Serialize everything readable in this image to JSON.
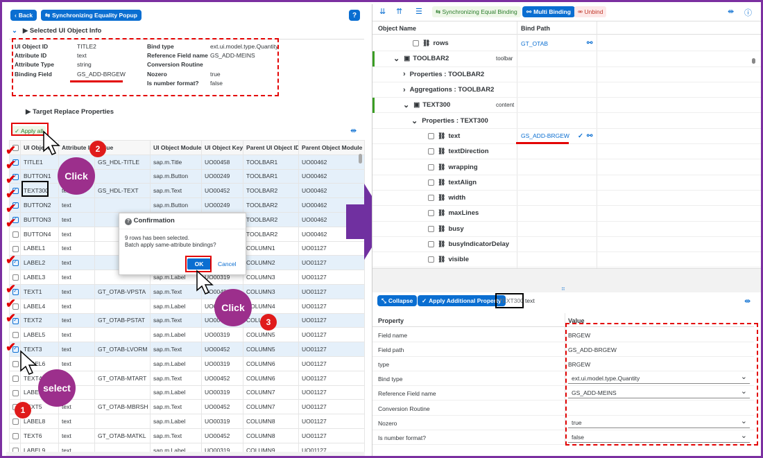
{
  "left": {
    "back": "Back",
    "sync_popup": "Synchronizing Equality Popup",
    "help": "?",
    "selected_info_title": "Selected UI Object Info",
    "info": [
      {
        "k": "UI Object ID",
        "v": "TITLE2"
      },
      {
        "k": "Attribute ID",
        "v": "text"
      },
      {
        "k": "Attribute Type",
        "v": "string"
      },
      {
        "k": "Binding Field",
        "v": "GS_ADD-BRGEW"
      }
    ],
    "info2": [
      {
        "k": "Bind type",
        "v": "ext.ui.model.type.Quantity"
      },
      {
        "k": "Reference Field name",
        "v": "GS_ADD-MEINS"
      },
      {
        "k": "Conversion Routine",
        "v": ""
      },
      {
        "k": "Nozero",
        "v": "true"
      },
      {
        "k": "Is number format?",
        "v": "false"
      }
    ],
    "target_title": "Target Replace Properties",
    "apply_all": "Apply all",
    "columns": [
      "UI Object",
      "Attribute ID",
      "Value",
      "UI Object Module",
      "UI Object Key",
      "Parent UI Object ID",
      "Parent Object Module"
    ],
    "rows": [
      [
        "TITLE1",
        "",
        "GS_HDL-TITLE",
        "sap.m.Title",
        "UO00458",
        "TOOLBAR1",
        "UO00462"
      ],
      [
        "BUTTON1",
        "",
        "",
        "sap.m.Button",
        "UO00249",
        "TOOLBAR1",
        "UO00462"
      ],
      [
        "TEXT300",
        "text",
        "GS_HDL-TEXT",
        "sap.m.Text",
        "UO00452",
        "TOOLBAR2",
        "UO00462"
      ],
      [
        "BUTTON2",
        "text",
        "",
        "sap.m.Button",
        "UO00249",
        "TOOLBAR2",
        "UO00462"
      ],
      [
        "BUTTON3",
        "text",
        "",
        "",
        "",
        "TOOLBAR2",
        "UO00462"
      ],
      [
        "BUTTON4",
        "text",
        "",
        "",
        "",
        "TOOLBAR2",
        "UO00462"
      ],
      [
        "LABEL1",
        "text",
        "",
        "",
        "",
        "COLUMN1",
        "UO01127"
      ],
      [
        "LABEL2",
        "text",
        "",
        "",
        "",
        "COLUMN2",
        "UO01127"
      ],
      [
        "LABEL3",
        "text",
        "",
        "sap.m.Label",
        "UO00319",
        "COLUMN3",
        "UO01127"
      ],
      [
        "TEXT1",
        "text",
        "GT_OTAB-VPSTA",
        "sap.m.Text",
        "UO00452",
        "COLUMN3",
        "UO01127"
      ],
      [
        "LABEL4",
        "text",
        "",
        "sap.m.Label",
        "UO00319",
        "COLUMN4",
        "UO01127"
      ],
      [
        "TEXT2",
        "text",
        "GT_OTAB-PSTAT",
        "sap.m.Text",
        "UO00452",
        "COLUMN4",
        "UO01127"
      ],
      [
        "LABEL5",
        "text",
        "",
        "sap.m.Label",
        "UO00319",
        "COLUMN5",
        "UO01127"
      ],
      [
        "TEXT3",
        "text",
        "GT_OTAB-LVORM",
        "sap.m.Text",
        "UO00452",
        "COLUMN5",
        "UO01127"
      ],
      [
        "LABEL6",
        "text",
        "",
        "sap.m.Label",
        "UO00319",
        "COLUMN6",
        "UO01127"
      ],
      [
        "TEXT4",
        "text",
        "GT_OTAB-MTART",
        "sap.m.Text",
        "UO00452",
        "COLUMN6",
        "UO01127"
      ],
      [
        "LABEL7",
        "text",
        "",
        "sap.m.Label",
        "UO00319",
        "COLUMN7",
        "UO01127"
      ],
      [
        "TEXT5",
        "text",
        "GT_OTAB-MBRSH",
        "sap.m.Text",
        "UO00452",
        "COLUMN7",
        "UO01127"
      ],
      [
        "LABEL8",
        "text",
        "",
        "sap.m.Label",
        "UO00319",
        "COLUMN8",
        "UO01127"
      ],
      [
        "TEXT6",
        "text",
        "GT_OTAB-MATKL",
        "sap.m.Text",
        "UO00452",
        "COLUMN8",
        "UO01127"
      ],
      [
        "LABEL9",
        "text",
        "",
        "sap.m.Label",
        "UO00319",
        "COLUMN9",
        "UO01127"
      ]
    ]
  },
  "dialog": {
    "title": "Confirmation",
    "line1": "9 rows has been selected.",
    "line2": "Batch apply same-attribute bindings?",
    "ok": "OK",
    "cancel": "Cancel"
  },
  "annotations": {
    "click1": "Click",
    "click2": "Click",
    "select": "select",
    "n1": "1",
    "n2": "2",
    "n3": "3"
  },
  "right": {
    "sync_binding": "Synchronizing Equal Binding",
    "multi_binding": "Multi Binding",
    "unbind": "Unbind",
    "col_object": "Object Name",
    "col_bind": "Bind Path",
    "tree": [
      {
        "label": "rows",
        "bind": "GT_OTAB",
        "tag": ""
      },
      {
        "label": "TOOLBAR2",
        "bind": "",
        "tag": "toolbar"
      },
      {
        "label": "Properties : TOOLBAR2",
        "bind": "",
        "tag": ""
      },
      {
        "label": "Aggregations : TOOLBAR2",
        "bind": "",
        "tag": ""
      },
      {
        "label": "TEXT300",
        "bind": "",
        "tag": "content"
      },
      {
        "label": "Properties : TEXT300",
        "bind": "",
        "tag": ""
      },
      {
        "label": "text",
        "bind": "GS_ADD-BRGEW",
        "tag": ""
      },
      {
        "label": "textDirection",
        "bind": "",
        "tag": ""
      },
      {
        "label": "wrapping",
        "bind": "",
        "tag": ""
      },
      {
        "label": "textAlign",
        "bind": "",
        "tag": ""
      },
      {
        "label": "width",
        "bind": "",
        "tag": ""
      },
      {
        "label": "maxLines",
        "bind": "",
        "tag": ""
      },
      {
        "label": "busy",
        "bind": "",
        "tag": ""
      },
      {
        "label": "busyIndicatorDelay",
        "bind": "",
        "tag": ""
      },
      {
        "label": "visible",
        "bind": "",
        "tag": ""
      }
    ],
    "collapse": "Collapse",
    "apply_additional": "Apply Additional Property",
    "obj_name": "TEXT300",
    "obj_attr": "text",
    "col_property": "Property",
    "col_value": "Value",
    "props": [
      {
        "k": "Field name",
        "v": "BRGEW"
      },
      {
        "k": "Field path",
        "v": "GS_ADD-BRGEW"
      },
      {
        "k": "type",
        "v": "BRGEW"
      },
      {
        "k": "Bind type",
        "v": "ext.ui.model.type.Quantity"
      },
      {
        "k": "Reference Field name",
        "v": "GS_ADD-MEINS"
      },
      {
        "k": "Conversion Routine",
        "v": ""
      },
      {
        "k": "Nozero",
        "v": "true"
      },
      {
        "k": "Is number format?",
        "v": "false"
      }
    ]
  },
  "colors": {
    "accent": "#0a6ed1",
    "annotation_red": "#e30000",
    "bubble": "#9c2f8c",
    "arrow": "#7030a0"
  }
}
